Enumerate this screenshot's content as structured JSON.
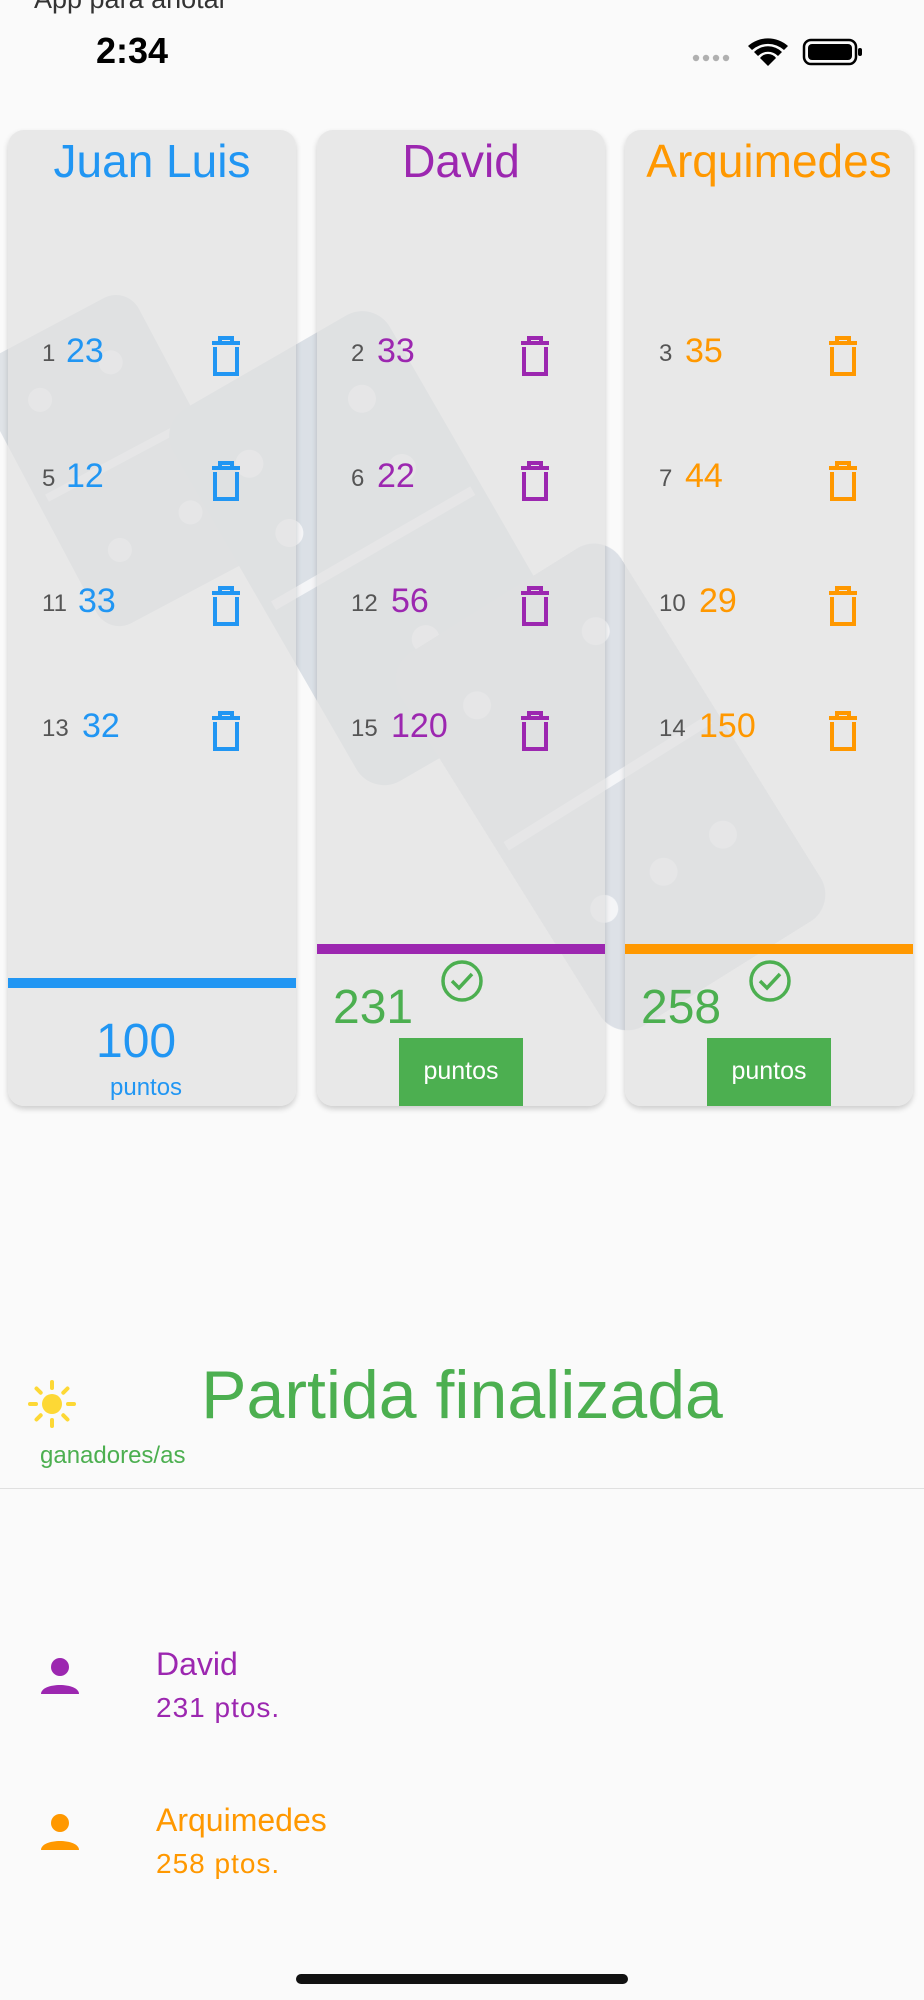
{
  "app": {
    "title": "App para anotar"
  },
  "status_bar": {
    "time": "2:34"
  },
  "colors": {
    "blue": "#2196f3",
    "purple": "#9c27b0",
    "orange": "#ff9800",
    "green": "#4caf50"
  },
  "players": [
    {
      "name": "Juan Luis",
      "entries": [
        {
          "index": "1",
          "value": "23"
        },
        {
          "index": "5",
          "value": "12"
        },
        {
          "index": "11",
          "value": "33"
        },
        {
          "index": "13",
          "value": "32"
        }
      ],
      "total": "100",
      "puntos_label": "puntos",
      "is_winner": false
    },
    {
      "name": "David",
      "entries": [
        {
          "index": "2",
          "value": "33"
        },
        {
          "index": "6",
          "value": "22"
        },
        {
          "index": "12",
          "value": "56"
        },
        {
          "index": "15",
          "value": "120"
        }
      ],
      "total": "231",
      "puntos_label": "puntos",
      "is_winner": true
    },
    {
      "name": "Arquimedes",
      "entries": [
        {
          "index": "3",
          "value": "35"
        },
        {
          "index": "7",
          "value": "44"
        },
        {
          "index": "10",
          "value": "29"
        },
        {
          "index": "14",
          "value": "150"
        }
      ],
      "total": "258",
      "puntos_label": "puntos",
      "is_winner": true
    }
  ],
  "result": {
    "title": "Partida finalizada",
    "winners_label": "ganadores/as",
    "winners": [
      {
        "name": "David",
        "points": "231 ptos."
      },
      {
        "name": "Arquimedes",
        "points": "258 ptos."
      }
    ]
  }
}
